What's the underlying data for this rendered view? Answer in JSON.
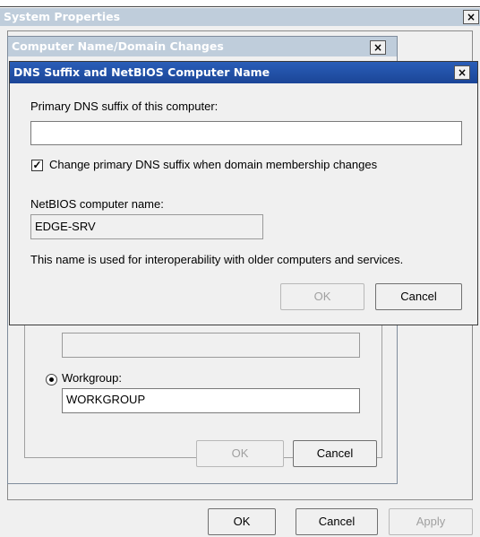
{
  "system_properties": {
    "title": "System Properties",
    "close_glyph": "×",
    "buttons": {
      "ok": "OK",
      "cancel": "Cancel",
      "apply": "Apply"
    }
  },
  "computer_name_dialog": {
    "title": "Computer Name/Domain Changes",
    "close_glyph": "×",
    "workgroup_label": "Workgroup:",
    "workgroup_value": "WORKGROUP",
    "domain_value": "",
    "workgroup_selected": true,
    "buttons": {
      "ok": "OK",
      "cancel": "Cancel"
    }
  },
  "dns_dialog": {
    "title": "DNS Suffix and NetBIOS Computer Name",
    "close_glyph": "×",
    "primary_dns_label": "Primary DNS suffix of this computer:",
    "primary_dns_value": "",
    "change_checkbox_label": "Change primary DNS suffix when domain membership changes",
    "change_checkbox_checked": true,
    "check_glyph": "✓",
    "netbios_label": "NetBIOS computer name:",
    "netbios_value": "EDGE-SRV",
    "info_text": "This name is used for interoperability with older computers and services.",
    "buttons": {
      "ok": "OK",
      "cancel": "Cancel"
    }
  }
}
